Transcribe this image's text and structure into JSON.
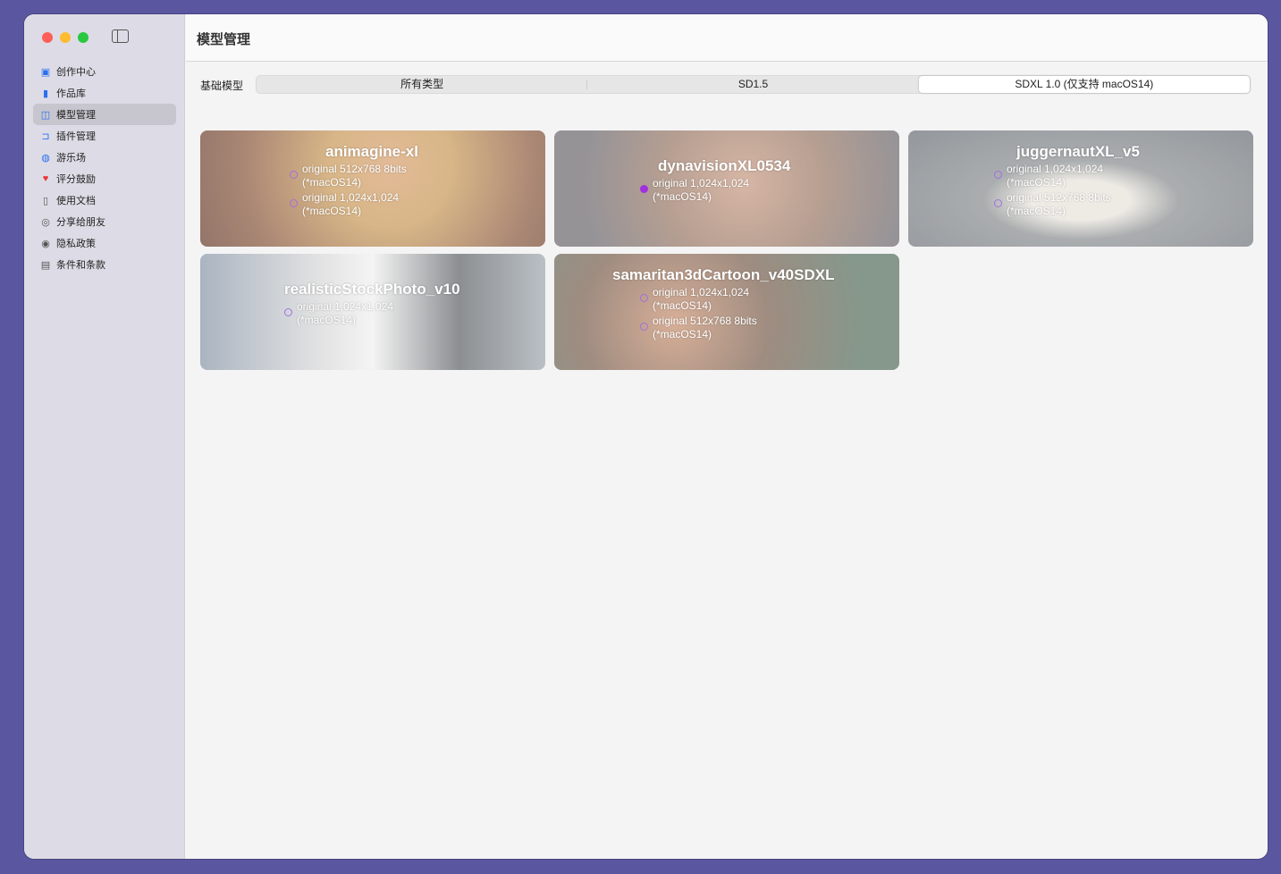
{
  "window": {
    "title": "模型管理"
  },
  "sidebar": {
    "items": [
      {
        "label": "创作中心",
        "icon": "photo-icon"
      },
      {
        "label": "作品库",
        "icon": "books-icon"
      },
      {
        "label": "模型管理",
        "icon": "cpu-icon",
        "active": true
      },
      {
        "label": "插件管理",
        "icon": "plugin-icon"
      },
      {
        "label": "游乐场",
        "icon": "palette-icon"
      },
      {
        "label": "评分鼓励",
        "icon": "heart-icon"
      },
      {
        "label": "使用文档",
        "icon": "doc-search-icon"
      },
      {
        "label": "分享给朋友",
        "icon": "share-icon"
      },
      {
        "label": "隐私政策",
        "icon": "lock-shield-icon"
      },
      {
        "label": "条件和条款",
        "icon": "document-icon"
      }
    ]
  },
  "filter": {
    "label": "基础模型",
    "options": [
      "所有类型",
      "SD1.5",
      "SDXL 1.0 (仅支持 macOS14)"
    ],
    "selected": "SDXL 1.0 (仅支持 macOS14)"
  },
  "models": [
    {
      "name": "animagine-xl",
      "options": [
        {
          "label": "original 512x768 8bits",
          "note": "(*macOS14)",
          "selected": false
        },
        {
          "label": "original 1,024x1,024",
          "note": "(*macOS14)",
          "selected": false
        }
      ]
    },
    {
      "name": "dynavisionXL0534",
      "options": [
        {
          "label": "original 1,024x1,024",
          "note": "(*macOS14)",
          "selected": true
        }
      ]
    },
    {
      "name": "juggernautXL_v5",
      "options": [
        {
          "label": "original 1,024x1,024",
          "note": "(*macOS14)",
          "selected": false
        },
        {
          "label": "original 512x768 8bits",
          "note": "(*macOS14)",
          "selected": false
        }
      ]
    },
    {
      "name": "realisticStockPhoto_v10",
      "options": [
        {
          "label": "original 1,024x1,024",
          "note": "(*macOS14)",
          "selected": false
        }
      ]
    },
    {
      "name": "samaritan3dCartoon_v40SDXL",
      "options": [
        {
          "label": "original 1,024x1,024",
          "note": "(*macOS14)",
          "selected": false
        },
        {
          "label": "original 512x768 8bits",
          "note": "(*macOS14)",
          "selected": false
        }
      ]
    }
  ]
}
